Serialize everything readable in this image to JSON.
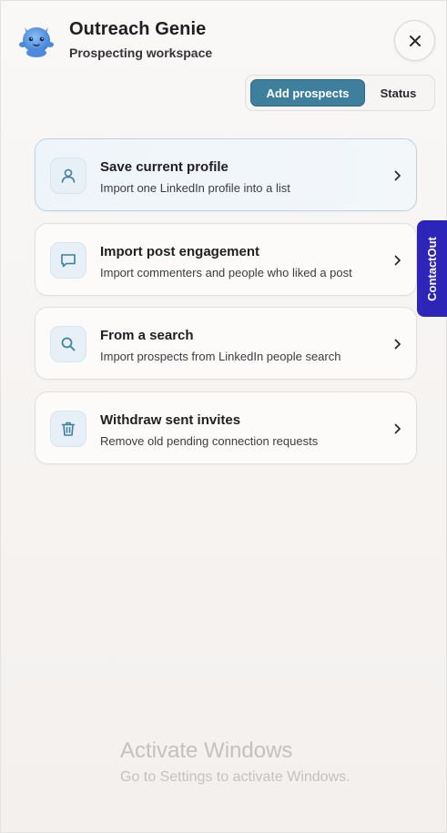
{
  "header": {
    "title": "Outreach Genie",
    "subtitle": "Prospecting workspace",
    "logo_icon": "genie-mascot-icon",
    "close_icon": "close-icon"
  },
  "tabs": [
    {
      "label": "Add prospects",
      "active": true
    },
    {
      "label": "Status",
      "active": false
    }
  ],
  "actions": [
    {
      "title": "Save current profile",
      "description": "Import one LinkedIn profile into a list",
      "icon": "user-icon",
      "highlighted": true
    },
    {
      "title": "Import post engagement",
      "description": "Import commenters and people who liked a post",
      "icon": "chat-bubble-icon",
      "highlighted": false
    },
    {
      "title": "From a search",
      "description": "Import prospects from LinkedIn people search",
      "icon": "search-icon",
      "highlighted": false
    },
    {
      "title": "Withdraw sent invites",
      "description": "Remove old pending connection requests",
      "icon": "trash-icon",
      "highlighted": false
    }
  ],
  "side_tab": {
    "label": "ContactOut"
  },
  "watermark": {
    "title": "Activate Windows",
    "subtitle": "Go to Settings to activate Windows."
  },
  "colors": {
    "accent": "#3f7f9e",
    "icon_stroke": "#3f7f9e",
    "contactout": "#2d24b8",
    "mascot": "#6aa4e8"
  }
}
